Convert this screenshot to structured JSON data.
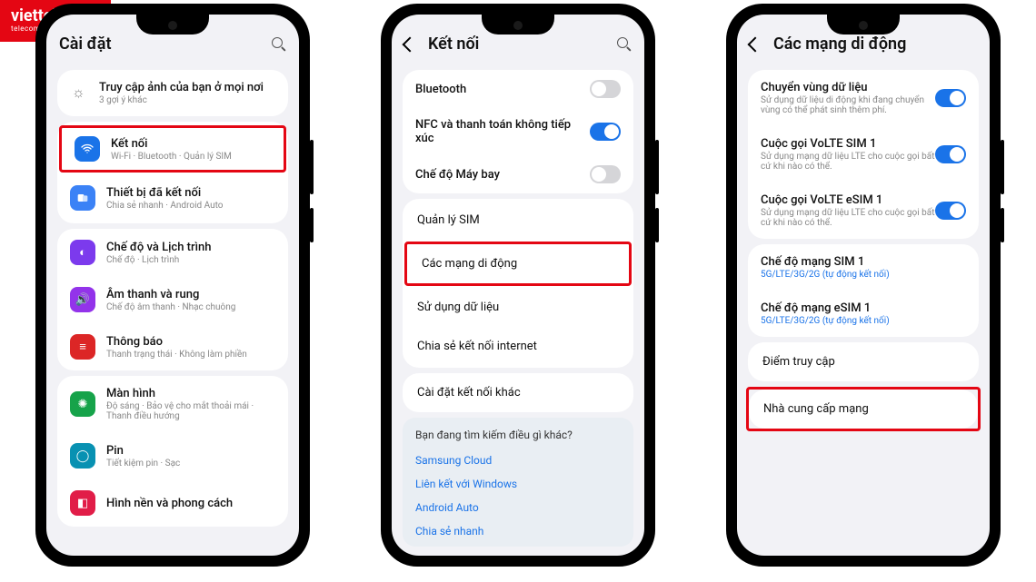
{
  "brand": {
    "main": "viettel",
    "sub": "telecom"
  },
  "phone1": {
    "header_title": "Cài đặt",
    "tip_title": "Truy cập ảnh của bạn ở mọi nơi",
    "tip_sub": "3 gợi ý khác",
    "items": [
      {
        "title": "Kết nối",
        "sub": "Wi-Fi · Bluetooth · Quản lý SIM",
        "color": "#1a73e8",
        "icon": "wifi-icon",
        "hl": true
      },
      {
        "title": "Thiết bị đã kết nối",
        "sub": "Chia sẻ nhanh · Android Auto",
        "color": "#3b82f6",
        "icon": "devices-icon",
        "hl": false
      }
    ],
    "group2": [
      {
        "title": "Chế độ và Lịch trình",
        "sub": "Chế độ · Lịch trình",
        "color": "#7c3aed",
        "icon": "mode-icon"
      },
      {
        "title": "Âm thanh và rung",
        "sub": "Chế độ âm thanh · Nhạc chuông",
        "color": "#9333ea",
        "icon": "sound-icon"
      },
      {
        "title": "Thông báo",
        "sub": "Thanh trạng thái · Không làm phiền",
        "color": "#dc2626",
        "icon": "notify-icon"
      }
    ],
    "group3": [
      {
        "title": "Màn hình",
        "sub": "Độ sáng · Bảo vệ cho mắt thoải mái · Thanh điều hướng",
        "color": "#16a34a",
        "icon": "display-icon"
      },
      {
        "title": "Pin",
        "sub": "Tiết kiệm pin · Sạc",
        "color": "#0891b2",
        "icon": "battery-icon"
      },
      {
        "title": "Hình nền và phong cách",
        "sub": "",
        "color": "#e11d48",
        "icon": "wallpaper-icon"
      }
    ]
  },
  "phone2": {
    "header_title": "Kết nối",
    "toggles": [
      {
        "title": "Bluetooth",
        "on": false
      },
      {
        "title": "NFC và thanh toán không tiếp xúc",
        "on": true
      },
      {
        "title": "Chế độ Máy bay",
        "on": false
      }
    ],
    "links": [
      {
        "title": "Quản lý SIM",
        "hl": false
      },
      {
        "title": "Các mạng di động",
        "hl": true
      },
      {
        "title": "Sử dụng dữ liệu",
        "hl": false
      },
      {
        "title": "Chia sẻ kết nối internet",
        "hl": false
      }
    ],
    "other": "Cài đặt kết nối khác",
    "looking_for": {
      "title": "Bạn đang tìm kiếm điều gì khác?",
      "links": [
        "Samsung Cloud",
        "Liên kết với Windows",
        "Android Auto",
        "Chia sẻ nhanh"
      ]
    }
  },
  "phone3": {
    "header_title": "Các mạng di động",
    "toggles": [
      {
        "title": "Chuyển vùng dữ liệu",
        "sub": "Sử dụng dữ liệu di động khi đang chuyển vùng có thể phát sinh thêm phí.",
        "on": true
      },
      {
        "title": "Cuộc gọi VoLTE SIM 1",
        "sub": "Sử dụng mạng dữ liệu LTE cho cuộc gọi bất cứ khi nào có thể.",
        "on": true
      },
      {
        "title": "Cuộc gọi VoLTE eSIM 1",
        "sub": "Sử dụng mạng dữ liệu LTE cho cuộc gọi bất cứ khi nào có thể.",
        "on": true
      }
    ],
    "modes": [
      {
        "title": "Chế độ mạng SIM 1",
        "sub": "5G/LTE/3G/2G (tự động kết nối)"
      },
      {
        "title": "Chế độ mạng eSIM 1",
        "sub": "5G/LTE/3G/2G (tự động kết nối)"
      }
    ],
    "apn": "Điểm truy cập",
    "provider": "Nhà cung cấp mạng"
  }
}
